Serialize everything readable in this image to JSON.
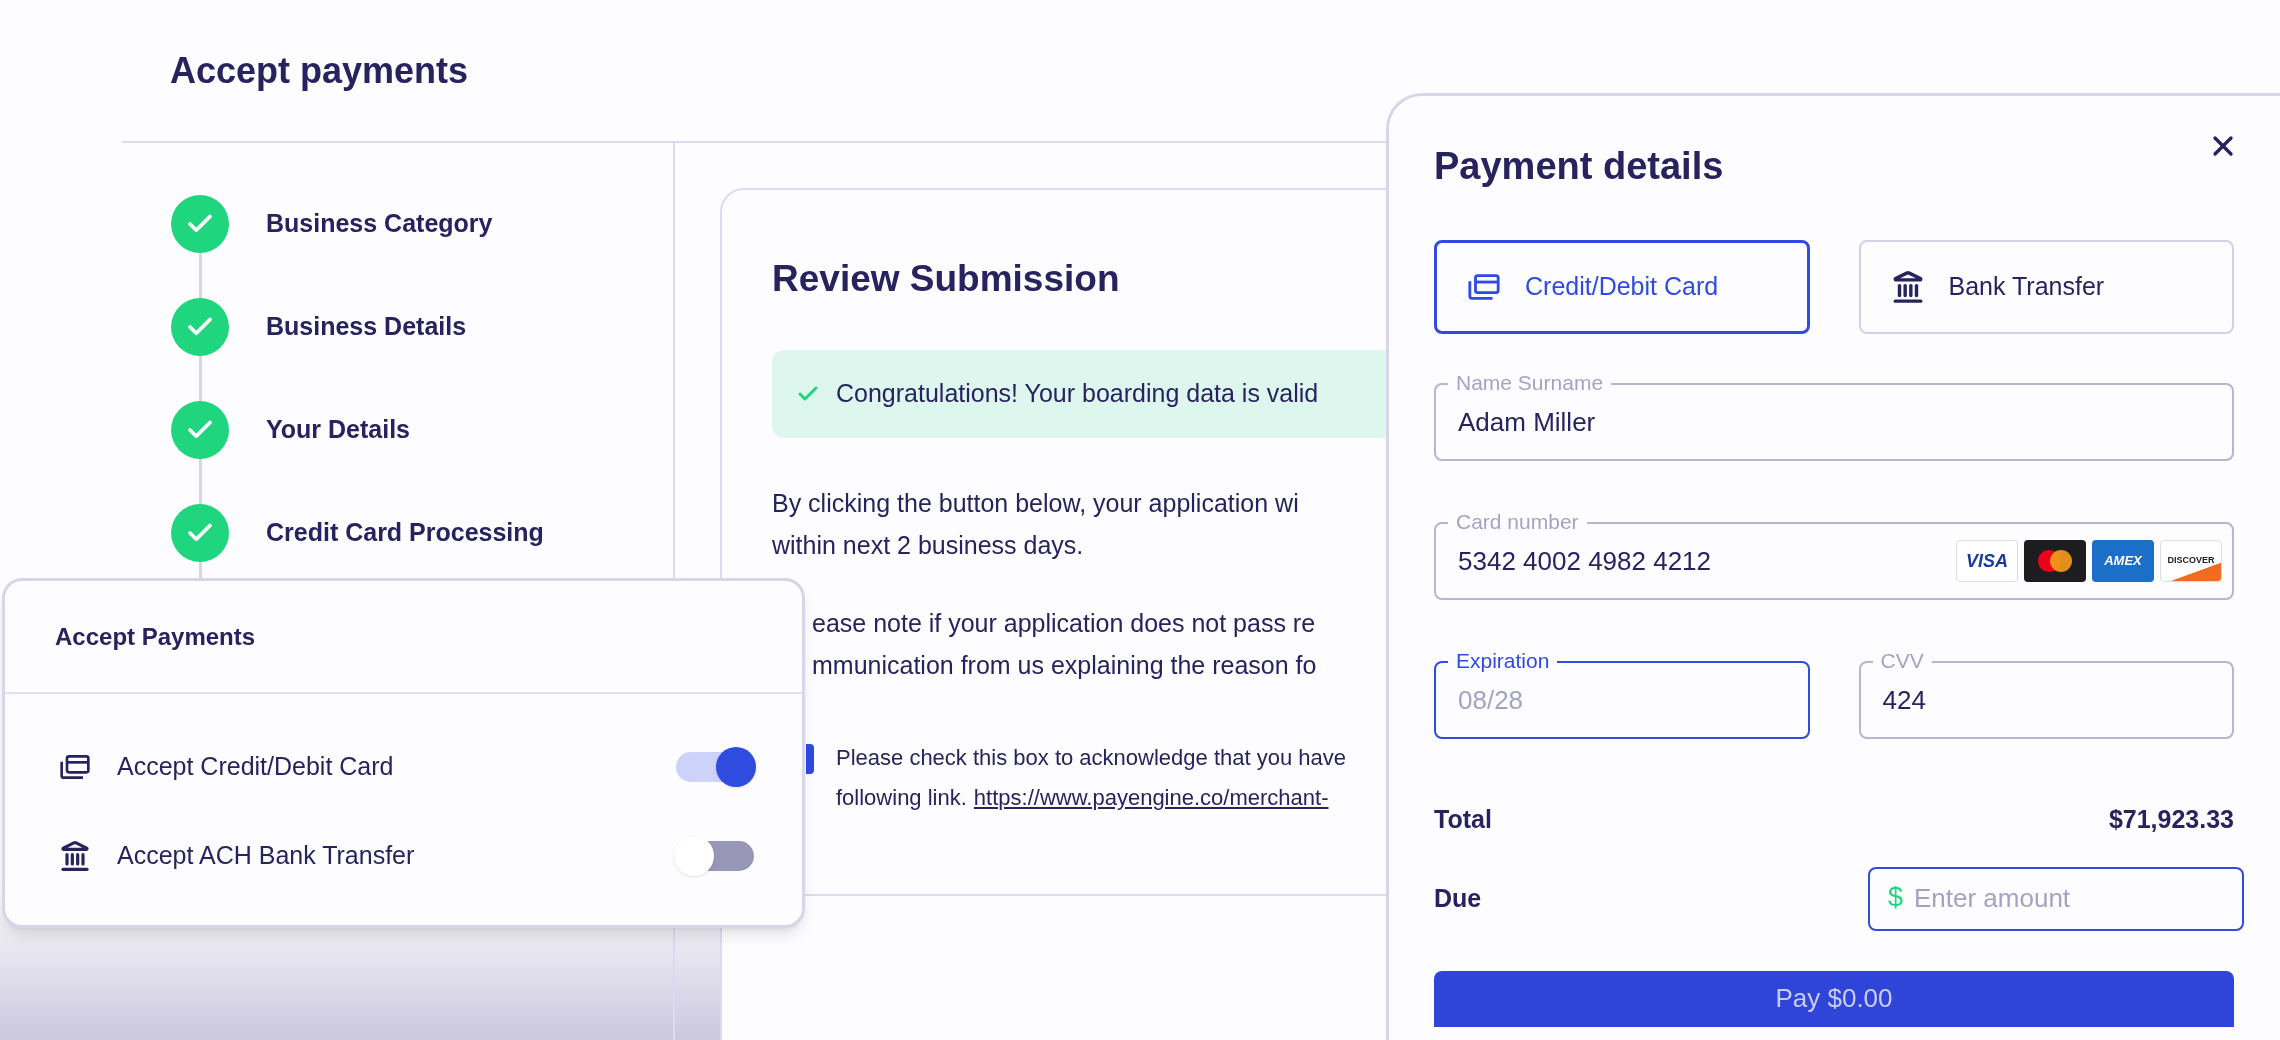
{
  "page": {
    "title": "Accept payments"
  },
  "steps": [
    {
      "label": "Business Category",
      "completed": true
    },
    {
      "label": "Business Details",
      "completed": true
    },
    {
      "label": "Your Details",
      "completed": true
    },
    {
      "label": "Credit Card Processing",
      "completed": true
    }
  ],
  "review": {
    "title": "Review Submission",
    "alert": "Congratulations! Your boarding data is valid",
    "paragraph_lines": [
      "By clicking the button below, your application wi",
      "within next 2 business days."
    ],
    "note_lines": [
      "ease note if your application does not pass re",
      "mmunication from us explaining the reason fo"
    ],
    "acknowledge": {
      "checked": true,
      "line_1": "Please check this box to acknowledge that you have",
      "line_2": "following link.",
      "link": "https://www.payengine.co/merchant-"
    }
  },
  "accept_payments": {
    "title": "Accept Payments",
    "options": [
      {
        "kind": "card",
        "label": "Accept Credit/Debit Card",
        "on": true
      },
      {
        "kind": "bank",
        "label": "Accept ACH Bank Transfer",
        "on": false
      }
    ]
  },
  "payment_details": {
    "title": "Payment details",
    "methods": [
      {
        "kind": "card",
        "label": "Credit/Debit Card",
        "selected": true
      },
      {
        "kind": "bank",
        "label": "Bank Transfer",
        "selected": false
      }
    ],
    "name_field": {
      "label": "Name Surname",
      "value": "Adam Miller",
      "focused": false
    },
    "card_field": {
      "label": "Card number",
      "value": "5342 4002 4982 4212",
      "focused": false
    },
    "card_logos": [
      {
        "kind": "visa",
        "text": "VISA"
      },
      {
        "kind": "mastercard"
      },
      {
        "kind": "amex",
        "text": "AMEX"
      },
      {
        "kind": "discover",
        "text": "DISCOVER"
      }
    ],
    "expiration_field": {
      "label": "Expiration",
      "placeholder": "08/28",
      "focused": true
    },
    "cvv_field": {
      "label": "CVV",
      "value": "424",
      "focused": false
    },
    "total": {
      "label": "Total",
      "value": "$71,923.33"
    },
    "due": {
      "label": "Due",
      "currency": "$",
      "placeholder": "Enter amount",
      "focused": true
    },
    "pay_button": "Pay $0.00"
  }
}
